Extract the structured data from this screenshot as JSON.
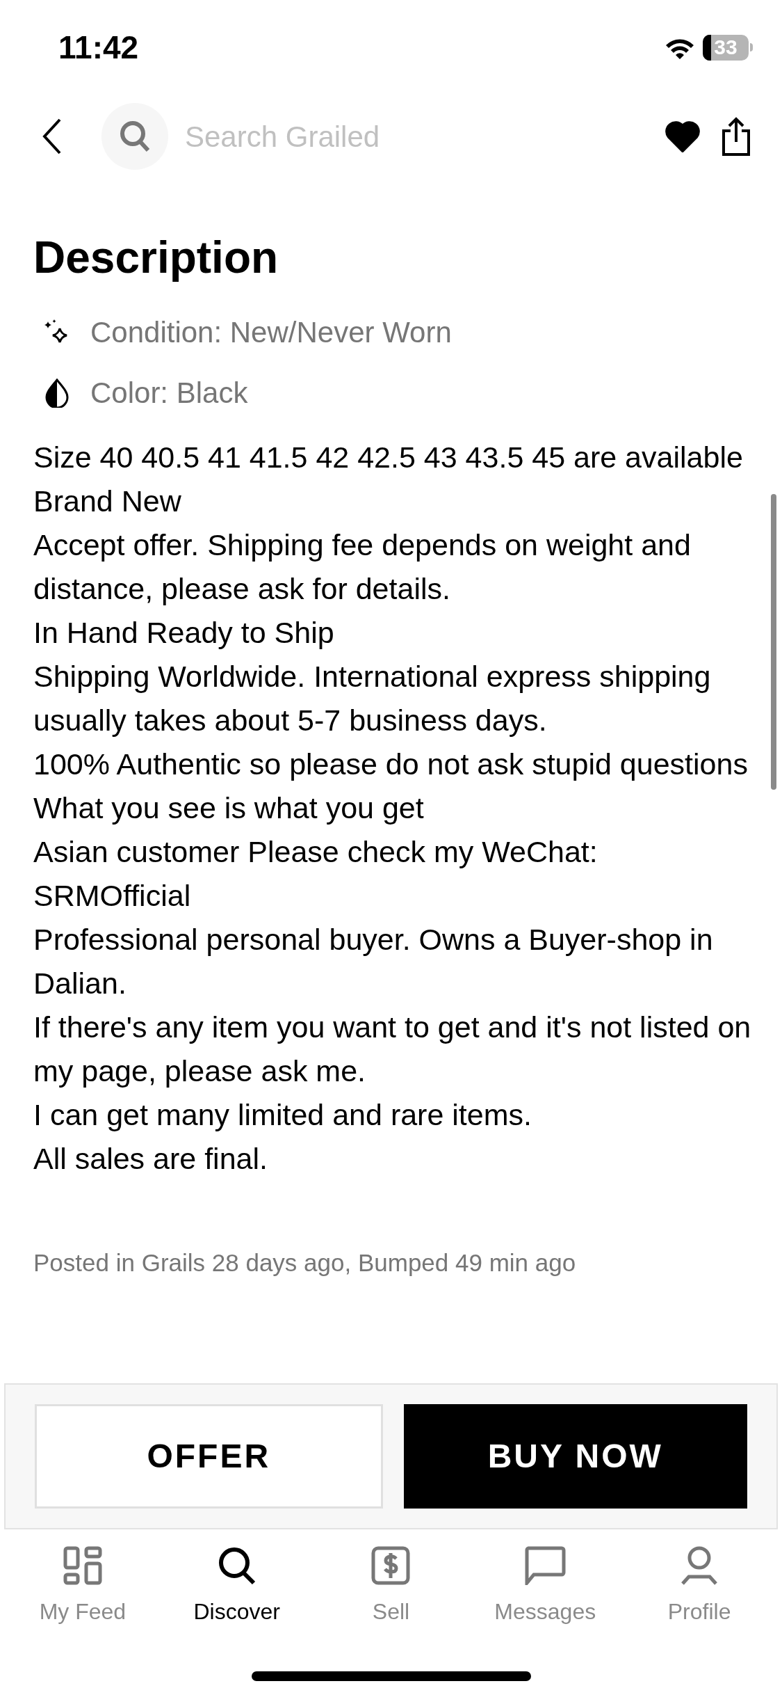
{
  "status_bar": {
    "time": "11:42",
    "battery": "33"
  },
  "search": {
    "placeholder": "Search Grailed"
  },
  "favorite": {
    "on": true
  },
  "description": {
    "title": "Description",
    "attributes": [
      {
        "kind": "condition",
        "text": "Condition: New/Never Worn"
      },
      {
        "kind": "color",
        "text": "Color: Black"
      }
    ],
    "paragraphs": [
      "Size 40 40.5 41 41.5 42 42.5 43 43.5 45 are available",
      "Brand New",
      "Accept offer. Shipping fee depends on weight and distance, please ask for details.",
      "In Hand Ready to Ship",
      "Shipping Worldwide. International express shipping usually takes about 5-7 business days.",
      "100% Authentic so please do not ask stupid questions",
      "What you see is what you get",
      "Asian customer Please check my WeChat: SRMOfficial",
      "Professional personal buyer. Owns a Buyer-shop in Dalian.",
      "If there's any item you want to get and it's not listed on my page, please ask me.",
      "I can get many limited and rare items.",
      "All sales are final."
    ],
    "posted": "Posted in Grails 28 days ago, Bumped 49 min ago"
  },
  "actions": {
    "offer": "OFFER",
    "buy_now": "BUY NOW"
  },
  "tabs": [
    {
      "kind": "feed",
      "label": "My Feed",
      "selected": false
    },
    {
      "kind": "discover",
      "label": "Discover",
      "selected": true
    },
    {
      "kind": "sell",
      "label": "Sell",
      "selected": false
    },
    {
      "kind": "messages",
      "label": "Messages",
      "selected": false
    },
    {
      "kind": "profile",
      "label": "Profile",
      "selected": false
    }
  ]
}
